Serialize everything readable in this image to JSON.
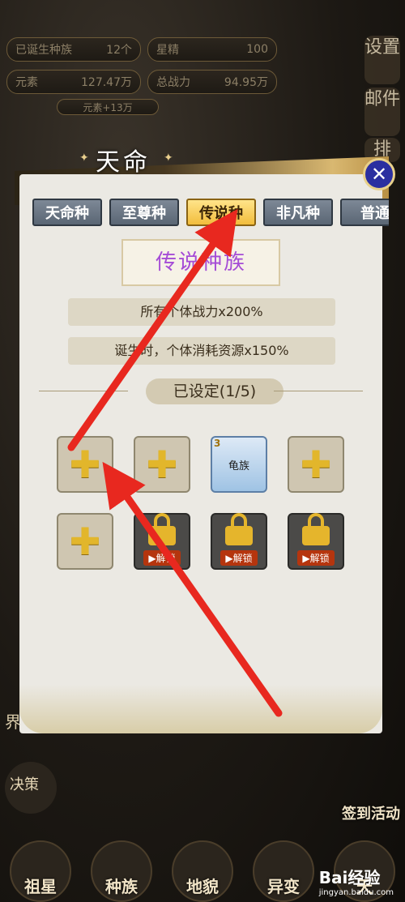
{
  "top": {
    "born_races_label": "已诞生种族",
    "born_races_value": "12个",
    "star_essence_label": "星精",
    "star_essence_value": "100",
    "element_label": "元素",
    "element_value": "127.47万",
    "total_power_label": "总战力",
    "total_power_value": "94.95万",
    "element_gain": "元素+13万"
  },
  "side": [
    "设置",
    "邮件",
    "排"
  ],
  "dialog": {
    "title": "天命",
    "tabs": [
      "天命种",
      "至尊种",
      "传说种",
      "非凡种",
      "普通"
    ],
    "active_tab": 2,
    "banner": "传说种族",
    "effects": [
      "所有个体战力x200%",
      "诞生时，个体消耗资源x150%"
    ],
    "set_status": "已设定(1/5)",
    "filled_slot": {
      "name": "龟族",
      "level": "3"
    },
    "unlock_label": "解锁"
  },
  "bottom_nav": [
    "祖星",
    "种族",
    "地貌",
    "异变",
    "天"
  ],
  "left_side": [
    "界",
    "决策"
  ],
  "right_side": "签到活动",
  "watermark": {
    "brand": "Bai经验",
    "url": "jingyan.baidu.com"
  },
  "colors": {
    "active_tab": "#f2bd3c",
    "banner_text": "#a54cd6",
    "arrow": "#e8281f"
  }
}
